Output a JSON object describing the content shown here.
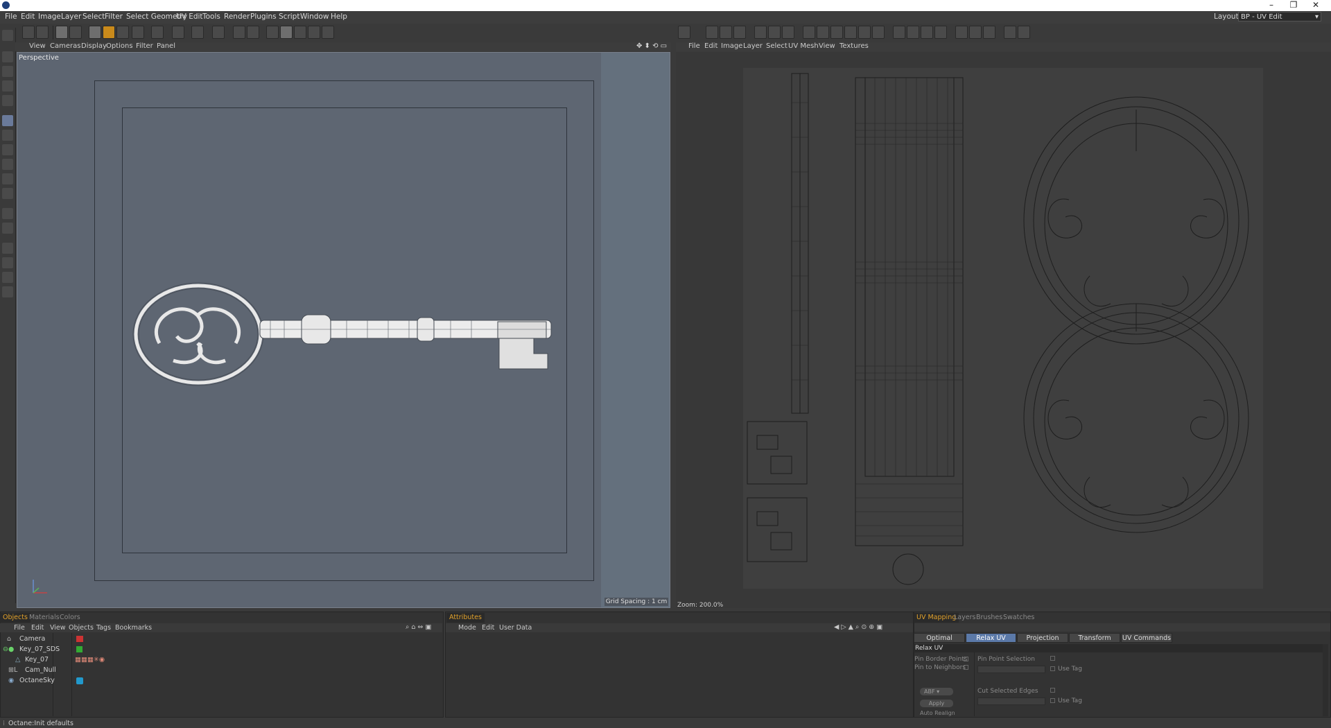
{
  "menubar": {
    "items": [
      "File",
      "Edit",
      "Image",
      "Layer",
      "Select",
      "Filter",
      "Select Geometry",
      "UV Edit",
      "Tools",
      "Render",
      "Plugins",
      "Script",
      "Window",
      "Help"
    ],
    "layout_label": "Layout:",
    "layout_value": "BP - UV Edit"
  },
  "viewport": {
    "menu": [
      "View",
      "Cameras",
      "Display",
      "Options",
      "Filter",
      "Panel"
    ],
    "camera_label": "Perspective",
    "grid_spacing": "Grid Spacing : 1 cm"
  },
  "uv_editor": {
    "menu": [
      "File",
      "Edit",
      "Image",
      "Layer",
      "Select",
      "UV Mesh",
      "View",
      "Textures"
    ],
    "zoom": "Zoom: 200.0%"
  },
  "objects_panel": {
    "tabs": [
      "Objects",
      "Materials",
      "Colors"
    ],
    "menu": [
      "File",
      "Edit",
      "View",
      "Objects",
      "Tags",
      "Bookmarks"
    ],
    "rows": [
      "Camera",
      "Key_07_SDS",
      "Key_07",
      "Cam_Null",
      "OctaneSky"
    ]
  },
  "attributes_panel": {
    "tabs": [
      "Attributes"
    ],
    "menu": [
      "Mode",
      "Edit",
      "User Data"
    ]
  },
  "uv_mapping_panel": {
    "tabs": [
      "UV Mapping",
      "Layers",
      "Brushes",
      "Swatches"
    ],
    "subtabs": [
      "Optimal Mapping",
      "Relax UV",
      "Projection",
      "Transform",
      "UV Commands"
    ],
    "section": "Relax UV",
    "options": {
      "pin_border": "Pin Border Points",
      "pin_neighbors": "Pin to Neighbors",
      "pin_selection": "Pin Point Selection",
      "use_tag_1": "Use Tag",
      "method": "ABF",
      "apply": "Apply",
      "auto_realign": "Auto Realign",
      "cut_edges": "Cut Selected Edges",
      "use_tag_2": "Use Tag"
    }
  },
  "status": "Octane:Init defaults",
  "colors": {
    "accent": "#e3a22a",
    "active_tab": "#5b79a8",
    "viewport_bg": "#5d6571"
  }
}
